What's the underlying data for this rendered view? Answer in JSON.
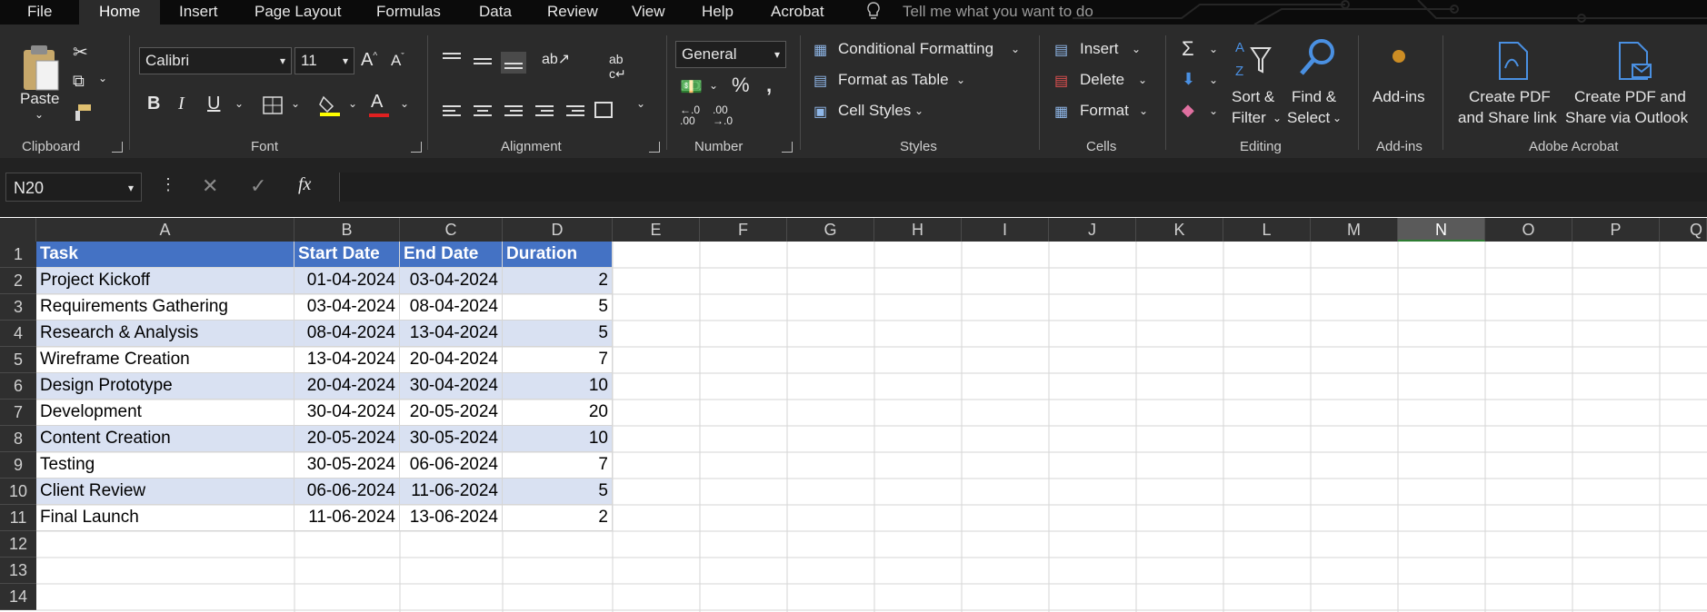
{
  "menu": {
    "tabs": [
      "File",
      "Home",
      "Insert",
      "Page Layout",
      "Formulas",
      "Data",
      "Review",
      "View",
      "Help",
      "Acrobat"
    ],
    "tell_me": "Tell me what you want to do"
  },
  "ribbon": {
    "clipboard": {
      "paste": "Paste",
      "label": "Clipboard"
    },
    "font": {
      "name": "Calibri",
      "size": "11",
      "bold": "B",
      "italic": "I",
      "underline": "U",
      "label": "Font"
    },
    "alignment": {
      "label": "Alignment"
    },
    "number": {
      "format": "General",
      "label": "Number"
    },
    "styles": {
      "conditional": "Conditional Formatting",
      "format_table": "Format as Table",
      "cell_styles": "Cell Styles",
      "label": "Styles"
    },
    "cells": {
      "insert": "Insert",
      "delete": "Delete",
      "format": "Format",
      "label": "Cells"
    },
    "editing": {
      "sort_line1": "Sort &",
      "sort_line2": "Filter",
      "find_line1": "Find &",
      "find_line2": "Select",
      "label": "Editing"
    },
    "addins": {
      "button": "Add-ins",
      "label": "Add-ins"
    },
    "acrobat": {
      "pdf_link_line1": "Create PDF",
      "pdf_link_line2": "and Share link",
      "pdf_outlook_line1": "Create PDF and",
      "pdf_outlook_line2": "Share via Outlook",
      "label": "Adobe Acrobat"
    }
  },
  "formula_bar": {
    "name_box": "N20",
    "fx": "fx",
    "value": ""
  },
  "grid": {
    "columns": [
      "A",
      "B",
      "C",
      "D",
      "E",
      "F",
      "G",
      "H",
      "I",
      "J",
      "K",
      "L",
      "M",
      "N",
      "O",
      "P",
      "Q"
    ],
    "selected_column": "N",
    "row_numbers": [
      "1",
      "2",
      "3",
      "4",
      "5",
      "6",
      "7",
      "8",
      "9",
      "10",
      "11",
      "12",
      "13",
      "14"
    ],
    "header": [
      "Task",
      "Start Date",
      "End Date",
      "Duration"
    ],
    "rows": [
      {
        "task": "Project Kickoff",
        "start": "01-04-2024",
        "end": "03-04-2024",
        "duration": "2"
      },
      {
        "task": "Requirements Gathering",
        "start": "03-04-2024",
        "end": "08-04-2024",
        "duration": "5"
      },
      {
        "task": "Research & Analysis",
        "start": "08-04-2024",
        "end": "13-04-2024",
        "duration": "5"
      },
      {
        "task": "Wireframe Creation",
        "start": "13-04-2024",
        "end": "20-04-2024",
        "duration": "7"
      },
      {
        "task": "Design Prototype",
        "start": "20-04-2024",
        "end": "30-04-2024",
        "duration": "10"
      },
      {
        "task": "Development",
        "start": "30-04-2024",
        "end": "20-05-2024",
        "duration": "20"
      },
      {
        "task": "Content Creation",
        "start": "20-05-2024",
        "end": "30-05-2024",
        "duration": "10"
      },
      {
        "task": "Testing",
        "start": "30-05-2024",
        "end": "06-06-2024",
        "duration": "7"
      },
      {
        "task": "Client Review",
        "start": "06-06-2024",
        "end": "11-06-2024",
        "duration": "5"
      },
      {
        "task": "Final Launch",
        "start": "11-06-2024",
        "end": "13-06-2024",
        "duration": "2"
      }
    ]
  },
  "colors": {
    "header_fill": "#4472c4",
    "band_fill": "#d9e1f2",
    "ribbon_bg": "#2b2b2b",
    "menubar_bg": "#0b0b0b",
    "acrobat_icon": "#4a90e2",
    "addins_icon": "#f5a623"
  }
}
